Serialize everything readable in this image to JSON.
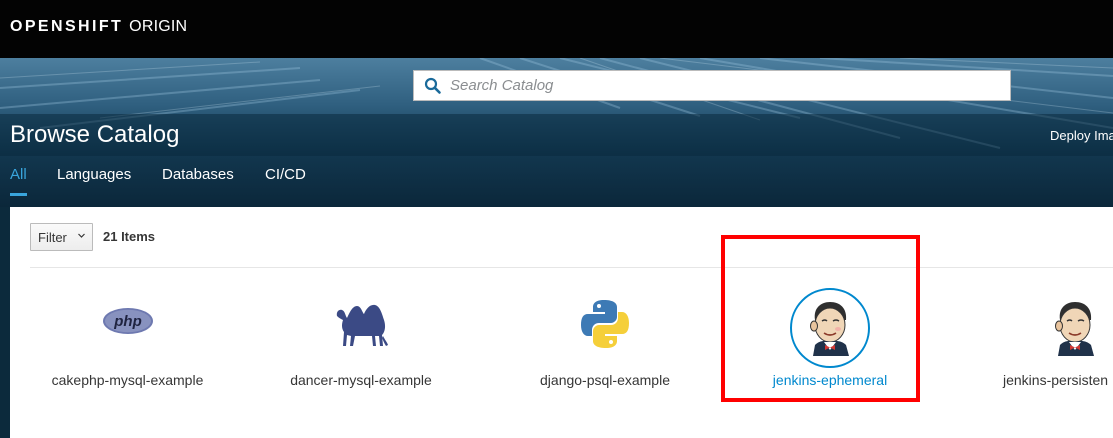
{
  "app": {
    "brand_bold": "OPENSHIFT",
    "brand_light": "ORIGIN"
  },
  "search": {
    "placeholder": "Search Catalog",
    "value": "",
    "icon": "search-icon"
  },
  "page": {
    "title": "Browse Catalog",
    "deploy_link": "Deploy Ima"
  },
  "tabs": [
    {
      "label": "All",
      "active": true
    },
    {
      "label": "Languages",
      "active": false
    },
    {
      "label": "Databases",
      "active": false
    },
    {
      "label": "CI/CD",
      "active": false
    }
  ],
  "toolbar": {
    "filter_label": "Filter",
    "item_count": "21 Items"
  },
  "catalog": [
    {
      "name": "cakephp-mysql-example",
      "icon": "php-icon",
      "logo_text": "php"
    },
    {
      "name": "dancer-mysql-example",
      "icon": "perl-camel-icon"
    },
    {
      "name": "django-psql-example",
      "icon": "python-icon"
    },
    {
      "name": "jenkins-ephemeral",
      "icon": "jenkins-icon",
      "highlighted": true
    },
    {
      "name": "jenkins-persisten",
      "icon": "jenkins-icon"
    }
  ],
  "colors": {
    "accent": "#39a5dc",
    "link": "#0088ce",
    "highlight_box": "#ff0000",
    "topbar": "#030303",
    "hero_dark": "#0b273a"
  }
}
